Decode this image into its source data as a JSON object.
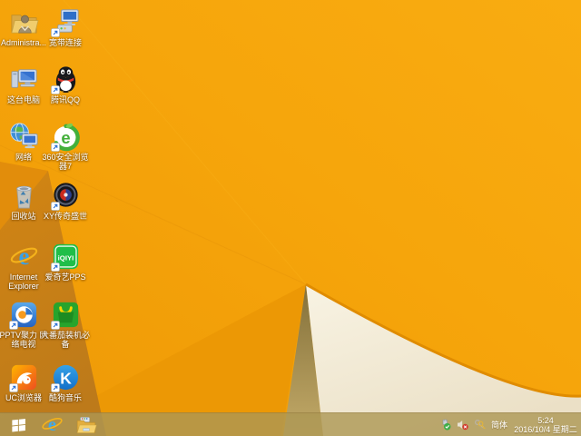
{
  "wallpaper": {
    "theme": "windows-8.1-orange-folded-paper",
    "colors": {
      "orange_base": "#ee9906",
      "orange_bright": "#f9ac11",
      "left_wedge": "#e28d0b",
      "dark_triangle": "#c77e14",
      "olive_shadow": "#a28c4e",
      "white_facet": "#f3ecda",
      "fold_edge": "#e08c00"
    }
  },
  "desktop": {
    "icons": [
      {
        "name": "administrator-folder",
        "label": "Administra..."
      },
      {
        "name": "broadband-connection",
        "label": "宽带连接"
      },
      {
        "name": "this-pc",
        "label": "这台电脑"
      },
      {
        "name": "tencent-qq",
        "label": "腾讯QQ"
      },
      {
        "name": "network",
        "label": "网络"
      },
      {
        "name": "360-safe-browser",
        "label": "360安全浏览器7"
      },
      {
        "name": "recycle-bin",
        "label": "回收站"
      },
      {
        "name": "xy-chuanqi-game",
        "label": "XY传奇盛世"
      },
      {
        "name": "internet-explorer",
        "label": "Internet Explorer"
      },
      {
        "name": "iqiyi-pps",
        "label": "爱奇艺PPS"
      },
      {
        "name": "pptv",
        "label": "PPTV聚力 网络电视"
      },
      {
        "name": "tomato-essentials",
        "label": "大番茄装机必备"
      },
      {
        "name": "uc-browser",
        "label": "UC浏览器"
      },
      {
        "name": "kugou-music",
        "label": "酷狗音乐"
      }
    ]
  },
  "icon_text": {
    "iqiyi": "iQIYI",
    "kugou": "K",
    "ie_letter": "e",
    "b360_letter": "e"
  },
  "taskbar": {
    "tray": {
      "language": "简体",
      "time": "5:24",
      "date": "2016/10/4 星期二"
    }
  }
}
